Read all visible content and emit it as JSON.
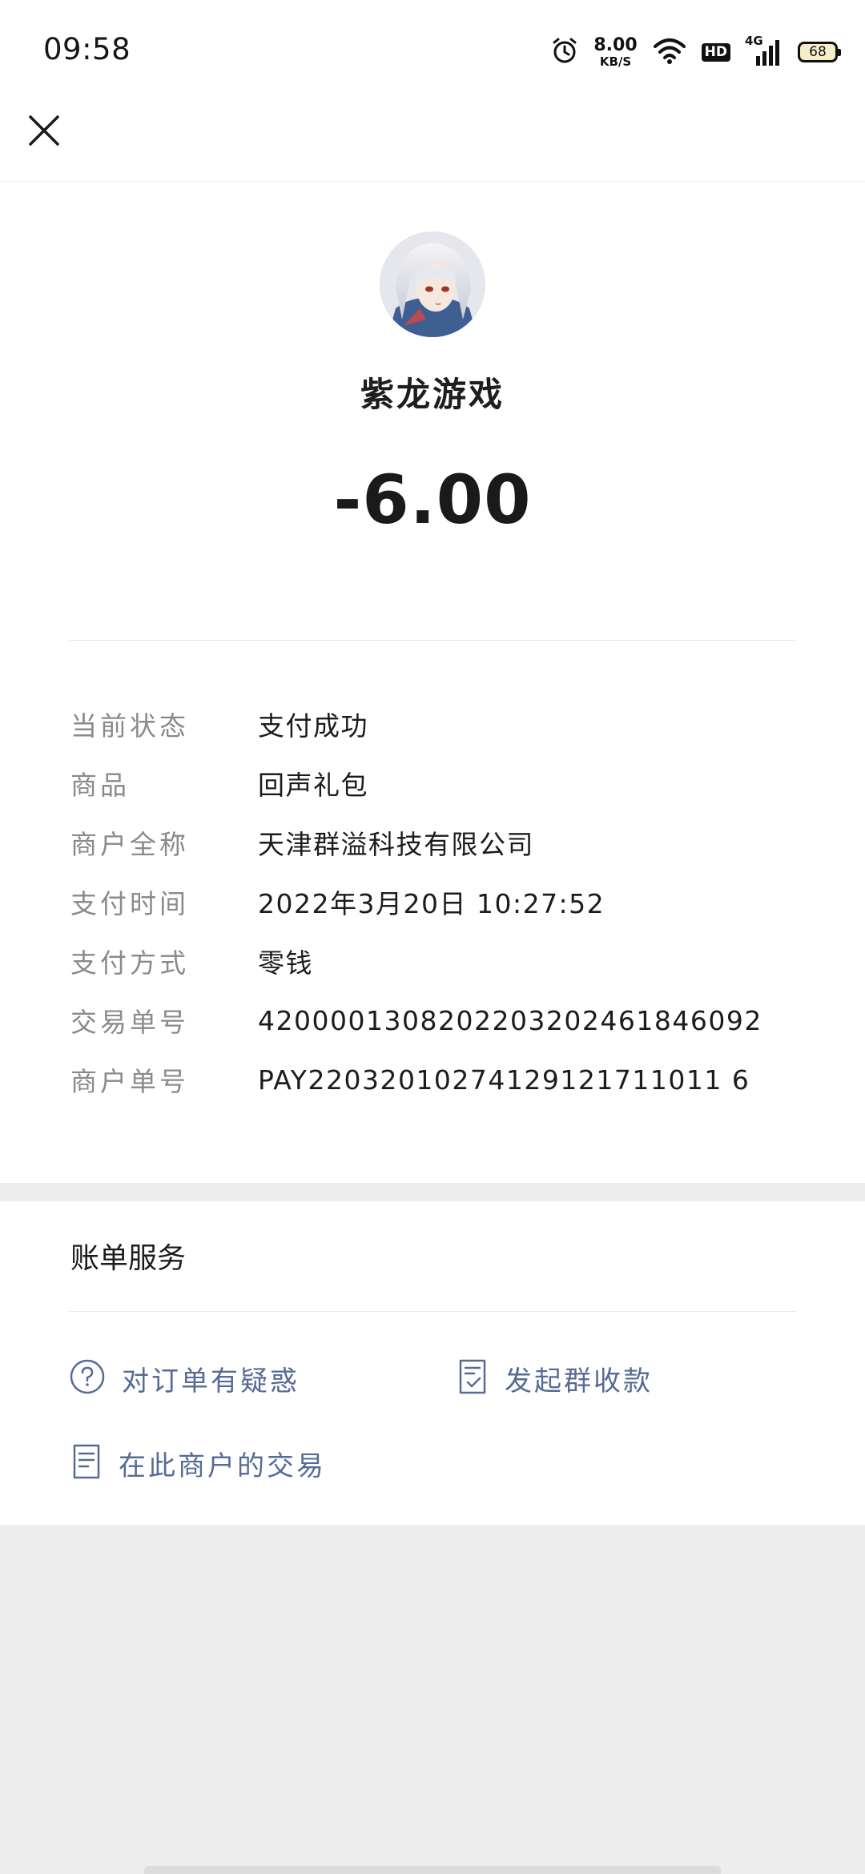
{
  "status_bar": {
    "time": "09:58",
    "net_speed_value": "8.00",
    "net_speed_unit": "KB/S",
    "hd_label": "HD",
    "signal_label": "4G",
    "battery": "68"
  },
  "nav": {
    "close_icon": "close-icon"
  },
  "merchant": {
    "name": "紫龙游戏",
    "amount": "-6.00"
  },
  "details": [
    {
      "label": "当前状态",
      "value": "支付成功"
    },
    {
      "label": "商品",
      "value": "回声礼包"
    },
    {
      "label": "商户全称",
      "value": "天津群溢科技有限公司"
    },
    {
      "label": "支付时间",
      "value": "2022年3月20日 10:27:52"
    },
    {
      "label": "支付方式",
      "value": "零钱"
    },
    {
      "label": "交易单号",
      "value": "4200001308202203202461846092"
    },
    {
      "label": "商户单号",
      "value": "PAY22032010274129121711011 6"
    }
  ],
  "services": {
    "title": "账单服务",
    "items": [
      {
        "label": "对订单有疑惑",
        "icon": "question-circle-icon"
      },
      {
        "label": "发起群收款",
        "icon": "document-check-icon"
      },
      {
        "label": "在此商户的交易",
        "icon": "document-list-icon"
      }
    ]
  },
  "colors": {
    "link": "#566b94",
    "label_gray": "#8a8a8a",
    "page_bg": "#ededed"
  }
}
